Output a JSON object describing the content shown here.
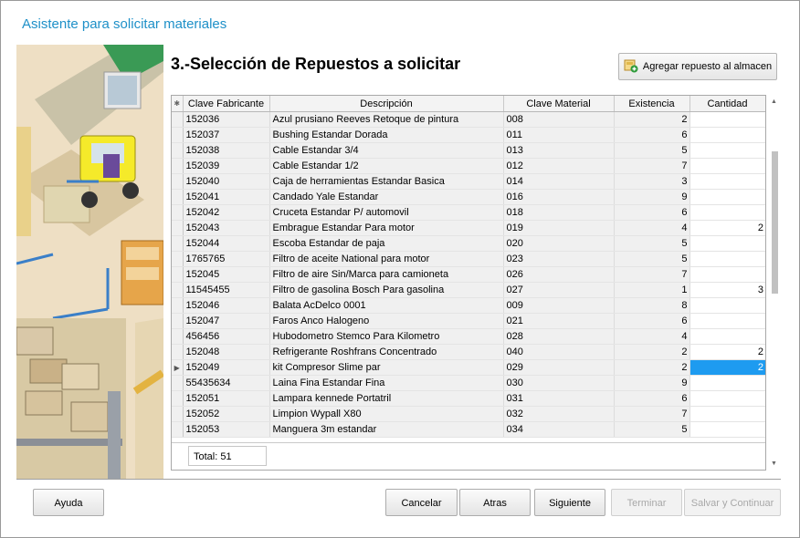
{
  "window": {
    "title": "Asistente para solicitar materiales"
  },
  "step": {
    "title": "3.-Selección de Repuestos a solicitar"
  },
  "toolbar": {
    "add_label": "Agregar repuesto al almacen",
    "add_icon": "add-box-icon"
  },
  "grid": {
    "columns": [
      "Clave Fabricante",
      "Descripción",
      "Clave Material",
      "Existencia",
      "Cantidad"
    ],
    "header_corner": "✱",
    "row_marker": "▶",
    "rows": [
      {
        "clave": "152036",
        "desc": "Azul prusiano Reeves Retoque de pintura",
        "mat": "008",
        "exist": "2",
        "cant": ""
      },
      {
        "clave": "152037",
        "desc": "Bushing Estandar Dorada",
        "mat": "011",
        "exist": "6",
        "cant": ""
      },
      {
        "clave": "152038",
        "desc": "Cable Estandar 3/4",
        "mat": "013",
        "exist": "5",
        "cant": ""
      },
      {
        "clave": "152039",
        "desc": "Cable Estandar 1/2",
        "mat": "012",
        "exist": "7",
        "cant": ""
      },
      {
        "clave": "152040",
        "desc": "Caja de herramientas Estandar Basica",
        "mat": "014",
        "exist": "3",
        "cant": ""
      },
      {
        "clave": "152041",
        "desc": "Candado Yale Estandar",
        "mat": "016",
        "exist": "9",
        "cant": ""
      },
      {
        "clave": "152042",
        "desc": "Cruceta Estandar P/ automovil",
        "mat": "018",
        "exist": "6",
        "cant": ""
      },
      {
        "clave": "152043",
        "desc": "Embrague Estandar Para motor",
        "mat": "019",
        "exist": "4",
        "cant": "2"
      },
      {
        "clave": "152044",
        "desc": "Escoba Estandar de paja",
        "mat": "020",
        "exist": "5",
        "cant": ""
      },
      {
        "clave": "1765765",
        "desc": "Filtro de aceite National para motor",
        "mat": "023",
        "exist": "5",
        "cant": ""
      },
      {
        "clave": "152045",
        "desc": "Filtro de aire Sin/Marca para camioneta",
        "mat": "026",
        "exist": "7",
        "cant": ""
      },
      {
        "clave": "11545455",
        "desc": "Filtro de gasolina Bosch Para gasolina",
        "mat": "027",
        "exist": "1",
        "cant": "3"
      },
      {
        "clave": "152046",
        "desc": "Balata AcDelco 0001",
        "mat": "009",
        "exist": "8",
        "cant": ""
      },
      {
        "clave": "152047",
        "desc": "Faros Anco Halogeno",
        "mat": "021",
        "exist": "6",
        "cant": ""
      },
      {
        "clave": "456456",
        "desc": "Hubodometro Stemco Para Kilometro",
        "mat": "028",
        "exist": "4",
        "cant": ""
      },
      {
        "clave": "152048",
        "desc": "Refrigerante Roshfrans Concentrado",
        "mat": "040",
        "exist": "2",
        "cant": "2"
      },
      {
        "clave": "152049",
        "desc": "kit Compresor Slime par",
        "mat": "029",
        "exist": "2",
        "cant": "2"
      },
      {
        "clave": "55435634",
        "desc": "Laina Fina Estandar Fina",
        "mat": "030",
        "exist": "9",
        "cant": ""
      },
      {
        "clave": "152051",
        "desc": "Lampara kennede Portatril",
        "mat": "031",
        "exist": "6",
        "cant": ""
      },
      {
        "clave": "152052",
        "desc": "Limpion Wypall X80",
        "mat": "032",
        "exist": "7",
        "cant": ""
      },
      {
        "clave": "152053",
        "desc": "Manguera 3m estandar",
        "mat": "034",
        "exist": "5",
        "cant": ""
      }
    ],
    "total_label": "Total: 51"
  },
  "buttons": {
    "help": "Ayuda",
    "cancel": "Cancelar",
    "back": "Atras",
    "next": "Siguiente",
    "finish": "Terminar",
    "save_continue": "Salvar y Continuar"
  },
  "colors": {
    "title": "#1e90c8",
    "selection": "#1e9bf0"
  }
}
